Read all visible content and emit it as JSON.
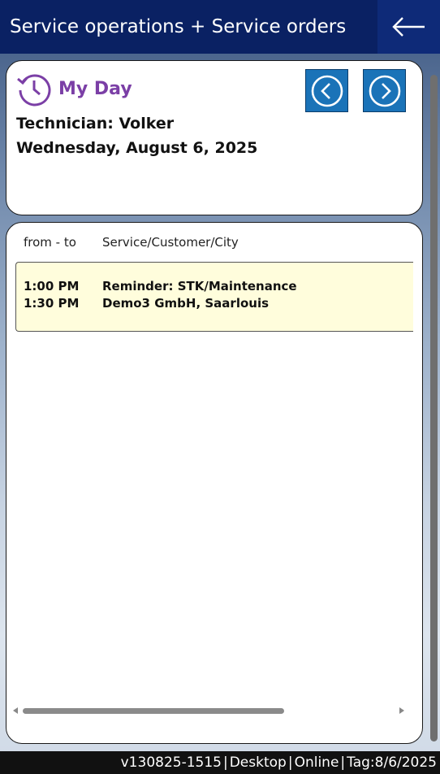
{
  "header": {
    "title": "Service operations + Service orders",
    "back_icon": "arrow-left-icon"
  },
  "summary": {
    "section_label": "My Day",
    "section_icon": "history-clock-icon",
    "technician": "Technician: Volker",
    "date": "Wednesday, August 6, 2025",
    "prev_icon": "chevron-left-circle-icon",
    "next_icon": "chevron-right-circle-icon"
  },
  "list": {
    "columns": {
      "from_to": "from - to",
      "service": "Service/Customer/City"
    },
    "entries": [
      {
        "start": "1:00 PM",
        "end": "1:30 PM",
        "service": "Reminder: STK/Maintenance",
        "customer_city": "Demo3 GmbH, Saarlouis"
      }
    ]
  },
  "footer": {
    "version": "v130825-1515",
    "platform": "Desktop",
    "status": "Online",
    "tag": "Tag:8/6/2025",
    "separator": "|"
  },
  "colors": {
    "header_bg": "#0a2163",
    "accent_purple": "#7b3fa6",
    "nav_button": "#1a73b8",
    "entry_bg": "#fffddc"
  }
}
